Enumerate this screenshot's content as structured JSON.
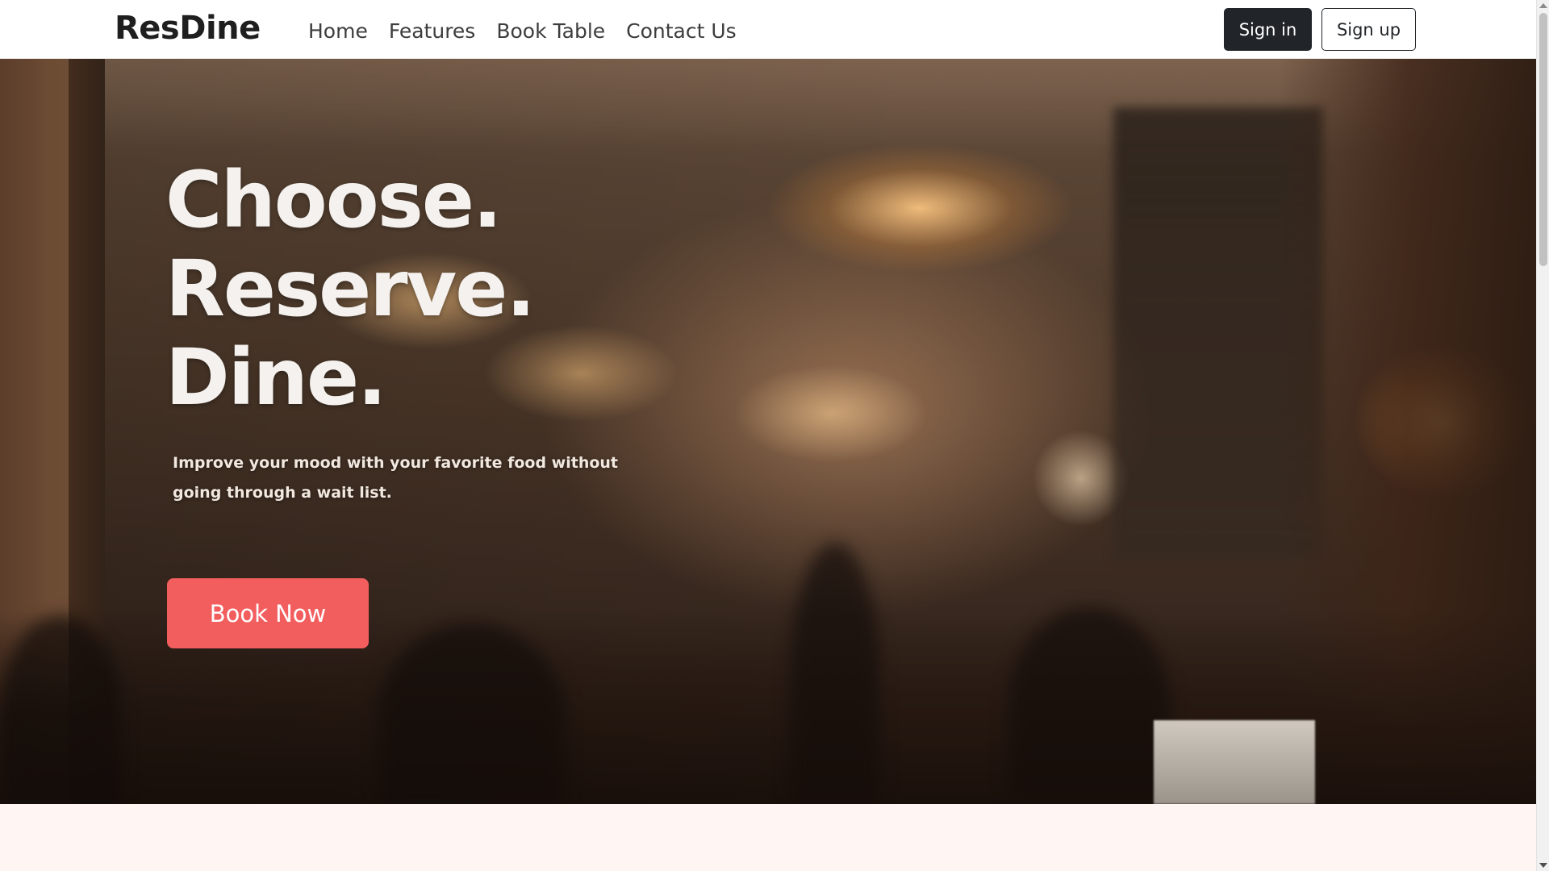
{
  "navbar": {
    "brand": "ResDine",
    "links": [
      "Home",
      "Features",
      "Book Table",
      "Contact Us"
    ],
    "sign_in_label": "Sign in",
    "sign_up_label": "Sign up"
  },
  "hero": {
    "headline": [
      "Choose.",
      "Reserve.",
      "Dine."
    ],
    "subtext": "Improve your mood with your favorite food without going through a wait list.",
    "cta_label": "Book Now"
  },
  "colors": {
    "accent": "#f25e5e",
    "dark_button": "#212529",
    "page_background": "#fff6f4"
  }
}
